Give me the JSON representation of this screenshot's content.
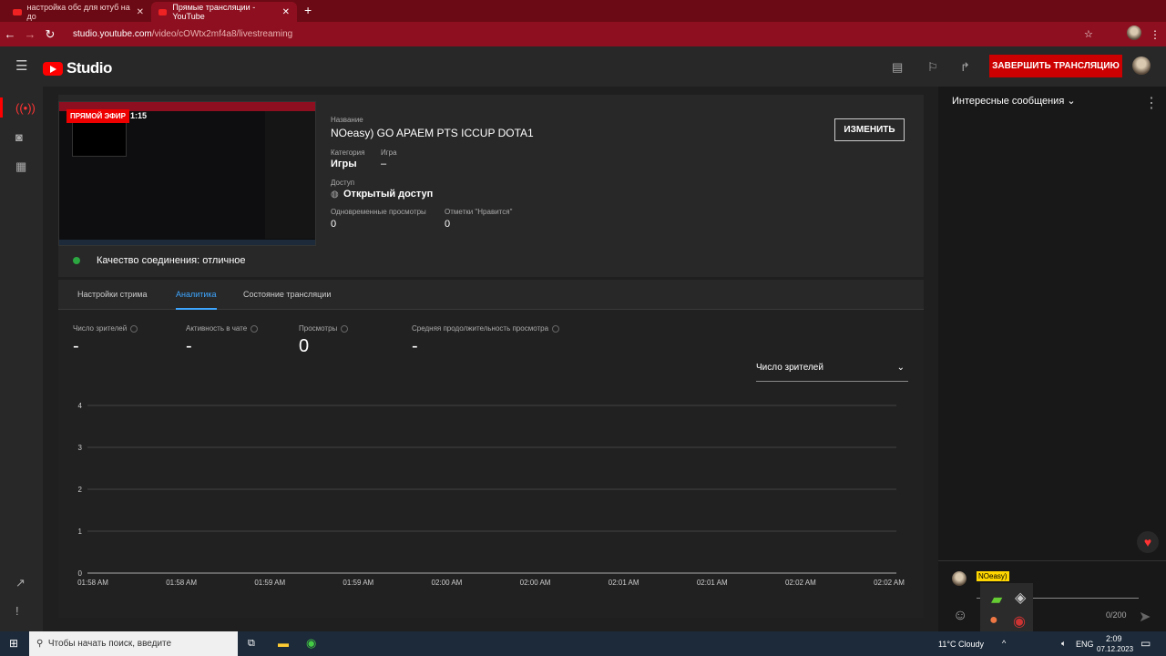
{
  "browser": {
    "tabs": [
      {
        "label": "настройка обс для ютуб на до",
        "active": false
      },
      {
        "label": "Прямые трансляции - YouTube",
        "active": true
      }
    ],
    "url_host": "studio.youtube.com",
    "url_path": "/video/cOWtx2mf4a8/livestreaming"
  },
  "header": {
    "logo": "Studio",
    "end_button": "ЗАВЕРШИТЬ ТРАНСЛЯЦИЮ"
  },
  "stream": {
    "live_badge": "ПРЯМОЙ ЭФИР",
    "elapsed": "1:15",
    "title_label": "Название",
    "title": "NOeasy) GO APAEM PTS ICCUP DOTA1",
    "category_label": "Категория",
    "category": "Игры",
    "game_label": "Игра",
    "game": "–",
    "access_label": "Доступ",
    "access": "Открытый доступ",
    "concurrent_label": "Одновременные просмотры",
    "concurrent": "0",
    "likes_label": "Отметки \"Нравится\"",
    "likes": "0",
    "edit_button": "ИЗМЕНИТЬ",
    "connection": "Качество соединения: отличное",
    "connection_color": "#2ba640"
  },
  "tabs": [
    {
      "label": "Настройки стрима"
    },
    {
      "label": "Аналитика",
      "active": true
    },
    {
      "label": "Состояние трансляции"
    }
  ],
  "metrics": [
    {
      "label": "Число зрителей",
      "value": "-"
    },
    {
      "label": "Активность в чате",
      "value": "-"
    },
    {
      "label": "Просмотры",
      "value": "0"
    },
    {
      "label": "Средняя продолжительность просмотра",
      "value": "-"
    }
  ],
  "chart_select": "Число зрителей",
  "chart_data": {
    "type": "line",
    "x": [
      "01:58 AM",
      "01:58 AM",
      "01:59 AM",
      "01:59 AM",
      "02:00 AM",
      "02:00 AM",
      "02:01 AM",
      "02:01 AM",
      "02:02 AM",
      "02:02 AM"
    ],
    "yticks": [
      "0",
      "1",
      "2",
      "3",
      "4"
    ],
    "ylim": [
      0,
      4
    ],
    "series": [],
    "grid": true
  },
  "chat": {
    "title": "Интересные сообщения",
    "user_badge": "NOeasy)",
    "counter": "0/200"
  },
  "taskbar": {
    "search_placeholder": "Чтобы начать поиск, введите",
    "weather": "11°C  Cloudy",
    "lang": "ENG",
    "time": "2:09",
    "date": "07.12.2023"
  },
  "colors": {
    "accent": "#3ea6ff",
    "brand": "#ff0000",
    "end_button": "#cc0000"
  }
}
